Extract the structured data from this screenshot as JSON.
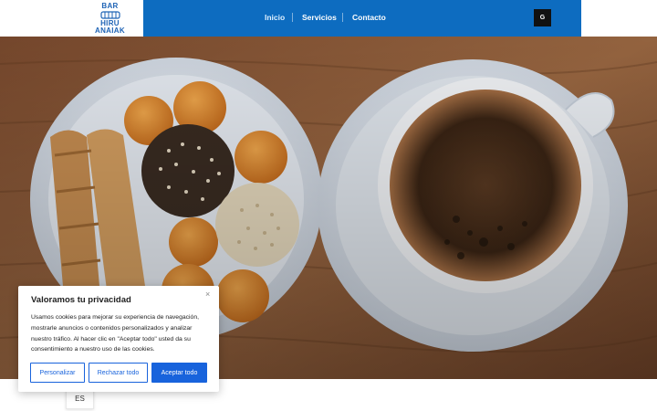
{
  "logo": {
    "top_text": "BAR",
    "line1": "HIRU",
    "line2": "ANAIAK"
  },
  "nav": {
    "items": [
      {
        "label": "Inicio",
        "active": true
      },
      {
        "label": "Servicios",
        "active": false
      },
      {
        "label": "Contacto",
        "active": false
      }
    ],
    "social_label": "G",
    "social_icon": "google-icon"
  },
  "hero": {
    "image": "coffee-and-pastries-photo"
  },
  "language": {
    "current": "ES"
  },
  "cookie_banner": {
    "title": "Valoramos tu privacidad",
    "close": "×",
    "body": "Usamos cookies para mejorar su experiencia de navegación, mostrarle anuncios o contenidos personalizados y analizar nuestro tráfico. Al hacer clic en \"Aceptar todo\" usted da su consentimiento a nuestro uso de las cookies.",
    "buttons": {
      "customize": "Personalizar",
      "reject": "Rechazar todo",
      "accept": "Aceptar todo"
    }
  },
  "colors": {
    "nav_blue": "#0d6cc0",
    "cookie_blue": "#1863dc",
    "logo_blue": "#1e63b5"
  }
}
